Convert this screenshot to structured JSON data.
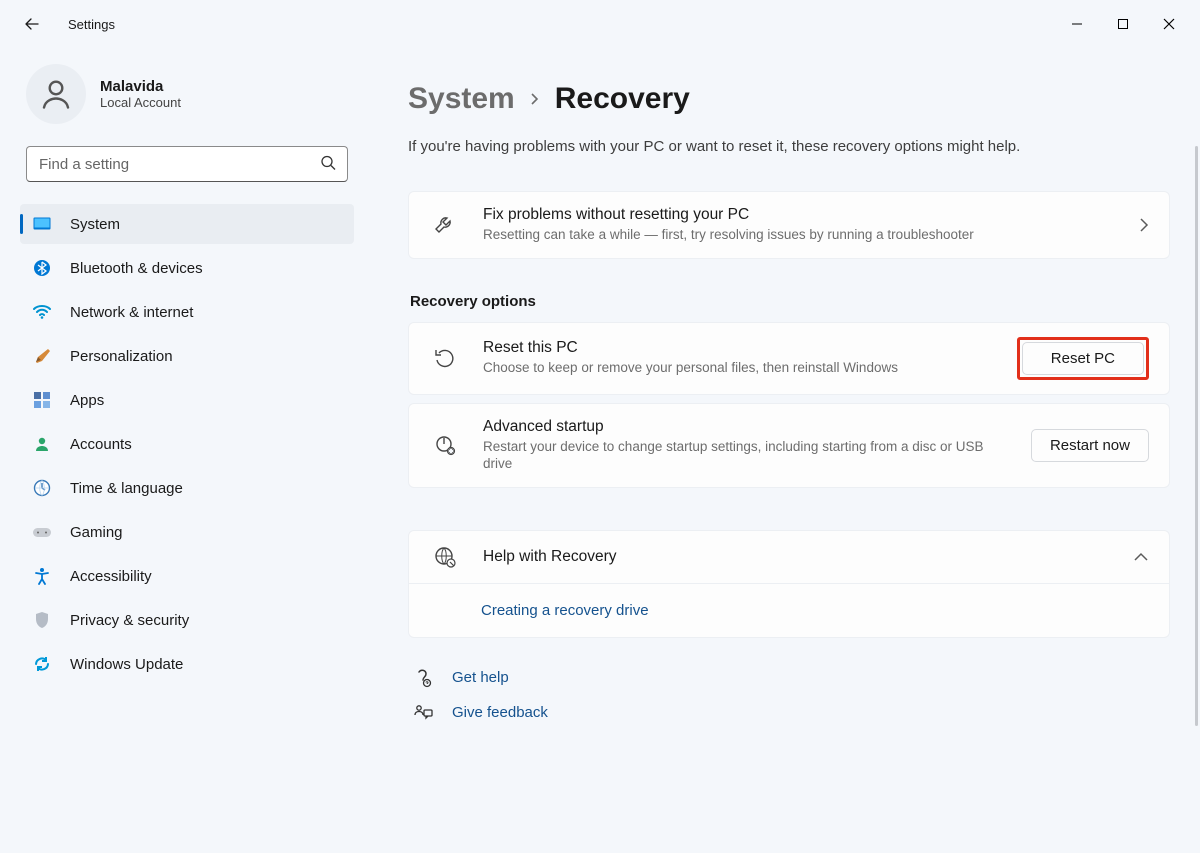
{
  "titlebar": {
    "app_name": "Settings"
  },
  "profile": {
    "name": "Malavida",
    "sub": "Local Account"
  },
  "search": {
    "placeholder": "Find a setting"
  },
  "sidebar": {
    "items": [
      {
        "label": "System",
        "active": true
      },
      {
        "label": "Bluetooth & devices"
      },
      {
        "label": "Network & internet"
      },
      {
        "label": "Personalization"
      },
      {
        "label": "Apps"
      },
      {
        "label": "Accounts"
      },
      {
        "label": "Time & language"
      },
      {
        "label": "Gaming"
      },
      {
        "label": "Accessibility"
      },
      {
        "label": "Privacy & security"
      },
      {
        "label": "Windows Update"
      }
    ]
  },
  "breadcrumb": {
    "parent": "System",
    "current": "Recovery"
  },
  "lead": "If you're having problems with your PC or want to reset it, these recovery options might help.",
  "fix_card": {
    "title": "Fix problems without resetting your PC",
    "desc": "Resetting can take a while — first, try resolving issues by running a troubleshooter"
  },
  "section_label": "Recovery options",
  "reset_card": {
    "title": "Reset this PC",
    "desc": "Choose to keep or remove your personal files, then reinstall Windows",
    "button": "Reset PC"
  },
  "advanced_card": {
    "title": "Advanced startup",
    "desc": "Restart your device to change startup settings, including starting from a disc or USB drive",
    "button": "Restart now"
  },
  "help_card": {
    "title": "Help with Recovery",
    "link": "Creating a recovery drive"
  },
  "footer": {
    "get_help": "Get help",
    "give_feedback": "Give feedback"
  }
}
